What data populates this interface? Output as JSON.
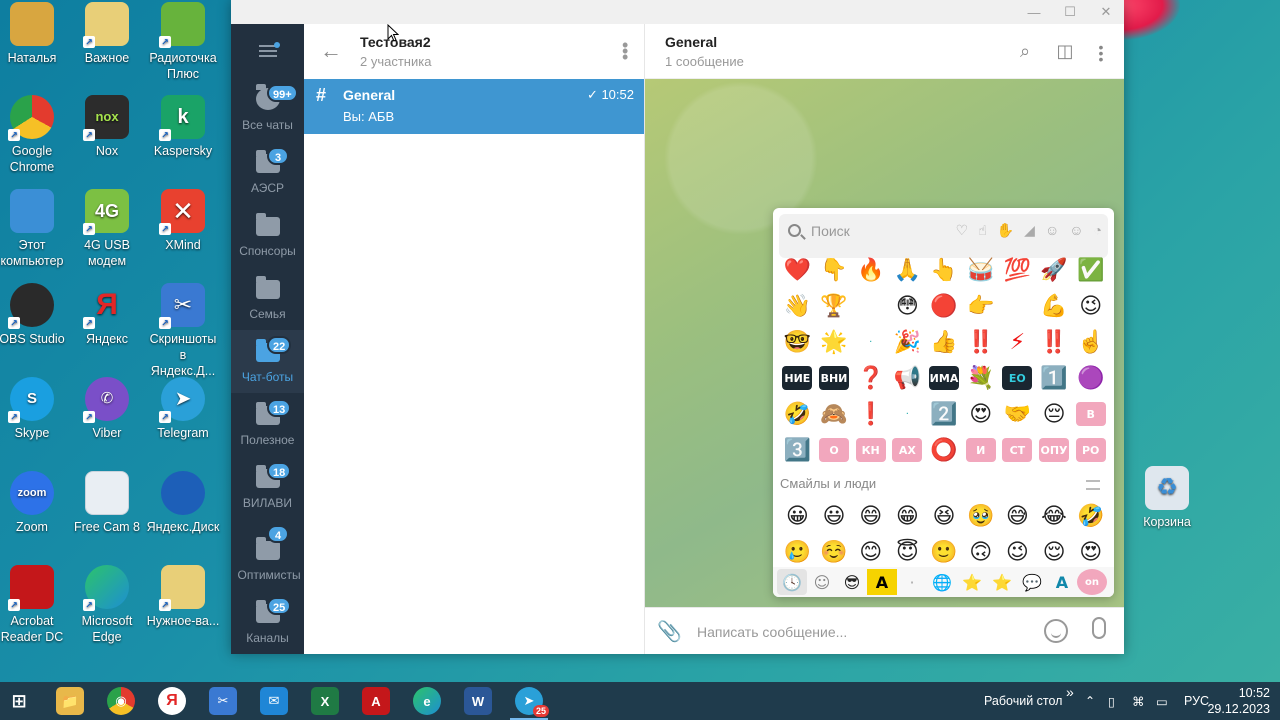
{
  "desktop": {
    "icons": [
      {
        "label": "Наталья",
        "color": "#d8a640",
        "glyph": ""
      },
      {
        "label": "Важное",
        "color": "#e8cf78",
        "glyph": ""
      },
      {
        "label": "Радиоточка Плюс",
        "color": "#67b33c",
        "glyph": ""
      },
      {
        "label": "Google Chrome",
        "color": "#e33b2e",
        "glyph": ""
      },
      {
        "label": "Nox",
        "color": "#2c2c2c",
        "glyph": "nox"
      },
      {
        "label": "Kaspersky",
        "color": "#1aa367",
        "glyph": "k"
      },
      {
        "label": "Этот компьютер",
        "color": "#3b8fd6",
        "glyph": ""
      },
      {
        "label": "4G USB модем",
        "color": "#7cc043",
        "glyph": "4G"
      },
      {
        "label": "XMind",
        "color": "#e8412f",
        "glyph": "✕"
      },
      {
        "label": "OBS Studio",
        "color": "#2a2a2a",
        "glyph": ""
      },
      {
        "label": "Яндекс",
        "color": "#e22727",
        "glyph": "Я"
      },
      {
        "label": "Скриншоты в Яндекс.Д...",
        "color": "#3a79d2",
        "glyph": "✂"
      },
      {
        "label": "Skype",
        "color": "#1a9fe0",
        "glyph": "S"
      },
      {
        "label": "Viber",
        "color": "#7a4fc8",
        "glyph": "✆"
      },
      {
        "label": "Telegram",
        "color": "#2aa0d8",
        "glyph": "➤"
      },
      {
        "label": "Zoom",
        "color": "#2d72e8",
        "glyph": "zoom"
      },
      {
        "label": "Free Cam 8",
        "color": "#e9eef3",
        "glyph": ""
      },
      {
        "label": "Яндекс.Диск",
        "color": "#1d5fb8",
        "glyph": ""
      },
      {
        "label": "Acrobat Reader DC",
        "color": "#c4171a",
        "glyph": ""
      },
      {
        "label": "Microsoft Edge",
        "color": "#1d8fd2",
        "glyph": ""
      },
      {
        "label": "Нужное-ва...",
        "color": "#e8cf78",
        "glyph": ""
      },
      {
        "label": "Корзина",
        "color": "#dfe7ee",
        "glyph": "♻"
      }
    ]
  },
  "telegram": {
    "folders": [
      {
        "label": "Все чаты",
        "badge": "99+"
      },
      {
        "label": "АЭСР",
        "badge": "3"
      },
      {
        "label": "Спонсоры",
        "badge": ""
      },
      {
        "label": "Семья",
        "badge": ""
      },
      {
        "label": "Чат-боты",
        "badge": "22"
      },
      {
        "label": "Полезное",
        "badge": "13"
      },
      {
        "label": "ВИЛАВИ",
        "badge": "18"
      },
      {
        "label": "Оптимисты",
        "badge": "4"
      },
      {
        "label": "Каналы",
        "badge": "25"
      }
    ],
    "group": {
      "title": "Тестовая2",
      "subtitle": "2 участника"
    },
    "chat": {
      "name": "General",
      "time": "10:52",
      "preview": "Вы: АБВ",
      "hash": "#"
    },
    "conversation": {
      "title": "General",
      "subtitle": "1 сообщение"
    },
    "composer": {
      "placeholder": "Написать сообщение..."
    }
  },
  "emoji_panel": {
    "search_placeholder": "Поиск",
    "category_icons": [
      "♡",
      "☝",
      "✋",
      "◢",
      "☺",
      "☺",
      "◔"
    ],
    "rows": [
      [
        "❤️",
        "👇",
        "🔥",
        "🙏",
        "👆",
        "🥁",
        "💯",
        "🚀",
        "✅"
      ],
      [
        "👋",
        "🏆",
        "",
        "😳",
        "🔴",
        "👉",
        "",
        "💪",
        "😉"
      ],
      [
        "🤓",
        "🌟",
        "·",
        "🎉",
        "👍",
        "‼️",
        "⚡",
        "‼️",
        "☝️"
      ],
      [
        "НИЕ",
        "ВНИ",
        "❓",
        "📢",
        "ИМА",
        "💐",
        "EO",
        "1️⃣",
        "🟣"
      ],
      [
        "🤣",
        "🙈",
        "❗",
        "·",
        "2️⃣",
        "😍",
        "🤝",
        "😔",
        "В"
      ],
      [
        "3️⃣",
        "О",
        "КН",
        "АХ",
        "⭕",
        "И",
        "СТ",
        "ОПУ",
        "РО"
      ]
    ],
    "section_label": "Смайлы и люди",
    "smileys_rows": [
      [
        "😀",
        "😃",
        "😄",
        "😁",
        "😆",
        "🥹",
        "😅",
        "😂",
        "🤣"
      ],
      [
        "🥲",
        "☺️",
        "😊",
        "😇",
        "🙂",
        "🙃",
        "😉",
        "😌",
        "😍"
      ]
    ],
    "tabs": [
      "🕓",
      "☺",
      "😎",
      "A",
      "·",
      "🌐",
      "⭐",
      "⭐",
      "💬",
      "A",
      "on"
    ]
  },
  "taskbar": {
    "apps": [
      "⊞",
      "📁",
      "◉",
      "Я",
      "✂",
      "✉",
      "X",
      "A",
      "e",
      "W",
      "➤"
    ],
    "telegram_badge": "25",
    "desktop_label": "Рабочий стол",
    "chevron": "»",
    "lang": "РУС",
    "time": "10:52",
    "date": "29.12.2023"
  },
  "colors": {
    "accent": "#3f96d1",
    "folders_bg": "#22303f",
    "taskbar": "#1f3b4c"
  }
}
